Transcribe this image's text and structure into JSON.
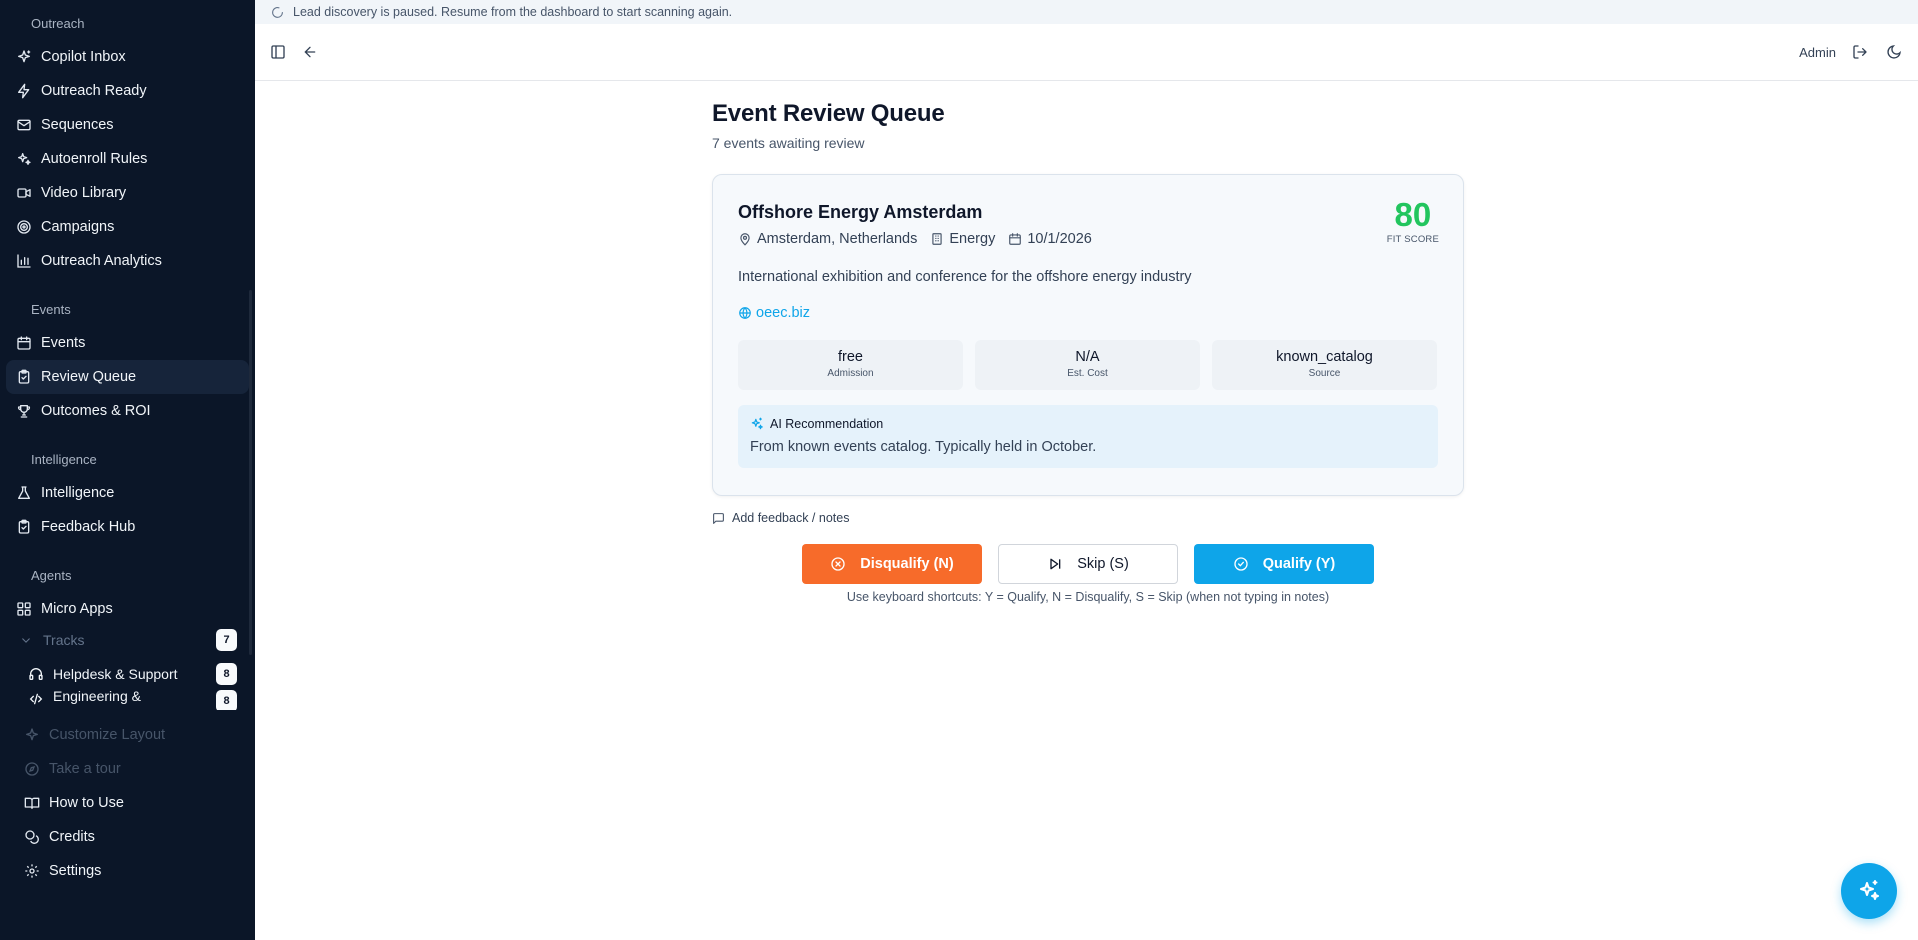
{
  "notice": {
    "text": "Lead discovery is paused. Resume from the dashboard to start scanning again."
  },
  "sidebar": {
    "sections": {
      "outreach": "Outreach",
      "events": "Events",
      "intelligence": "Intelligence",
      "agents": "Agents"
    },
    "outreach_items": [
      {
        "label": "Copilot Inbox",
        "icon": "sparkle-icon"
      },
      {
        "label": "Outreach Ready",
        "icon": "lightning-icon"
      },
      {
        "label": "Sequences",
        "icon": "mail-icon"
      },
      {
        "label": "Autoenroll Rules",
        "icon": "sparkles-icon"
      },
      {
        "label": "Video Library",
        "icon": "video-icon"
      },
      {
        "label": "Campaigns",
        "icon": "target-icon"
      },
      {
        "label": "Outreach Analytics",
        "icon": "bar-chart-icon"
      }
    ],
    "events_items": [
      {
        "label": "Events",
        "icon": "calendar-icon"
      },
      {
        "label": "Review Queue",
        "icon": "clipboard-check-icon"
      },
      {
        "label": "Outcomes & ROI",
        "icon": "trophy-icon"
      }
    ],
    "intelligence_items": [
      {
        "label": "Intelligence",
        "icon": "flask-icon"
      },
      {
        "label": "Feedback Hub",
        "icon": "clipboard-check-icon"
      }
    ],
    "agents_items": [
      {
        "label": "Micro Apps",
        "icon": "grid-icon"
      }
    ],
    "tracks": {
      "label": "Tracks",
      "count": "7"
    },
    "track_items": [
      {
        "label": "Helpdesk & Support",
        "count": "8"
      },
      {
        "label": "Engineering &",
        "count": "8"
      }
    ],
    "footer_items": [
      {
        "label": "Customize Layout"
      },
      {
        "label": "Take a tour"
      },
      {
        "label": "How to Use"
      },
      {
        "label": "Credits"
      },
      {
        "label": "Settings"
      }
    ]
  },
  "header": {
    "user": "Admin"
  },
  "page": {
    "title": "Event Review Queue",
    "subtitle": "7 events awaiting review"
  },
  "event": {
    "name": "Offshore Energy Amsterdam",
    "location": "Amsterdam, Netherlands",
    "industry": "Energy",
    "date": "10/1/2026",
    "score": "80",
    "score_label": "FIT SCORE",
    "description": "International exhibition and conference for the offshore energy industry",
    "website": "oeec.biz",
    "stats": [
      {
        "value": "free",
        "label": "Admission"
      },
      {
        "value": "N/A",
        "label": "Est. Cost"
      },
      {
        "value": "known_catalog",
        "label": "Source"
      }
    ],
    "ai_title": "AI Recommendation",
    "ai_text": "From known events catalog. Typically held in October."
  },
  "actions": {
    "feedback": "Add feedback / notes",
    "disqualify": "Disqualify (N)",
    "skip": "Skip (S)",
    "qualify": "Qualify (Y)",
    "shortcuts": "Use keyboard shortcuts: Y = Qualify, N = Disqualify, S = Skip (when not typing in notes)"
  },
  "colors": {
    "sidebar_bg": "#0b1628",
    "accent": "#0ea5e9",
    "score": "#22c55e",
    "disqualify": "#f76b2a"
  }
}
